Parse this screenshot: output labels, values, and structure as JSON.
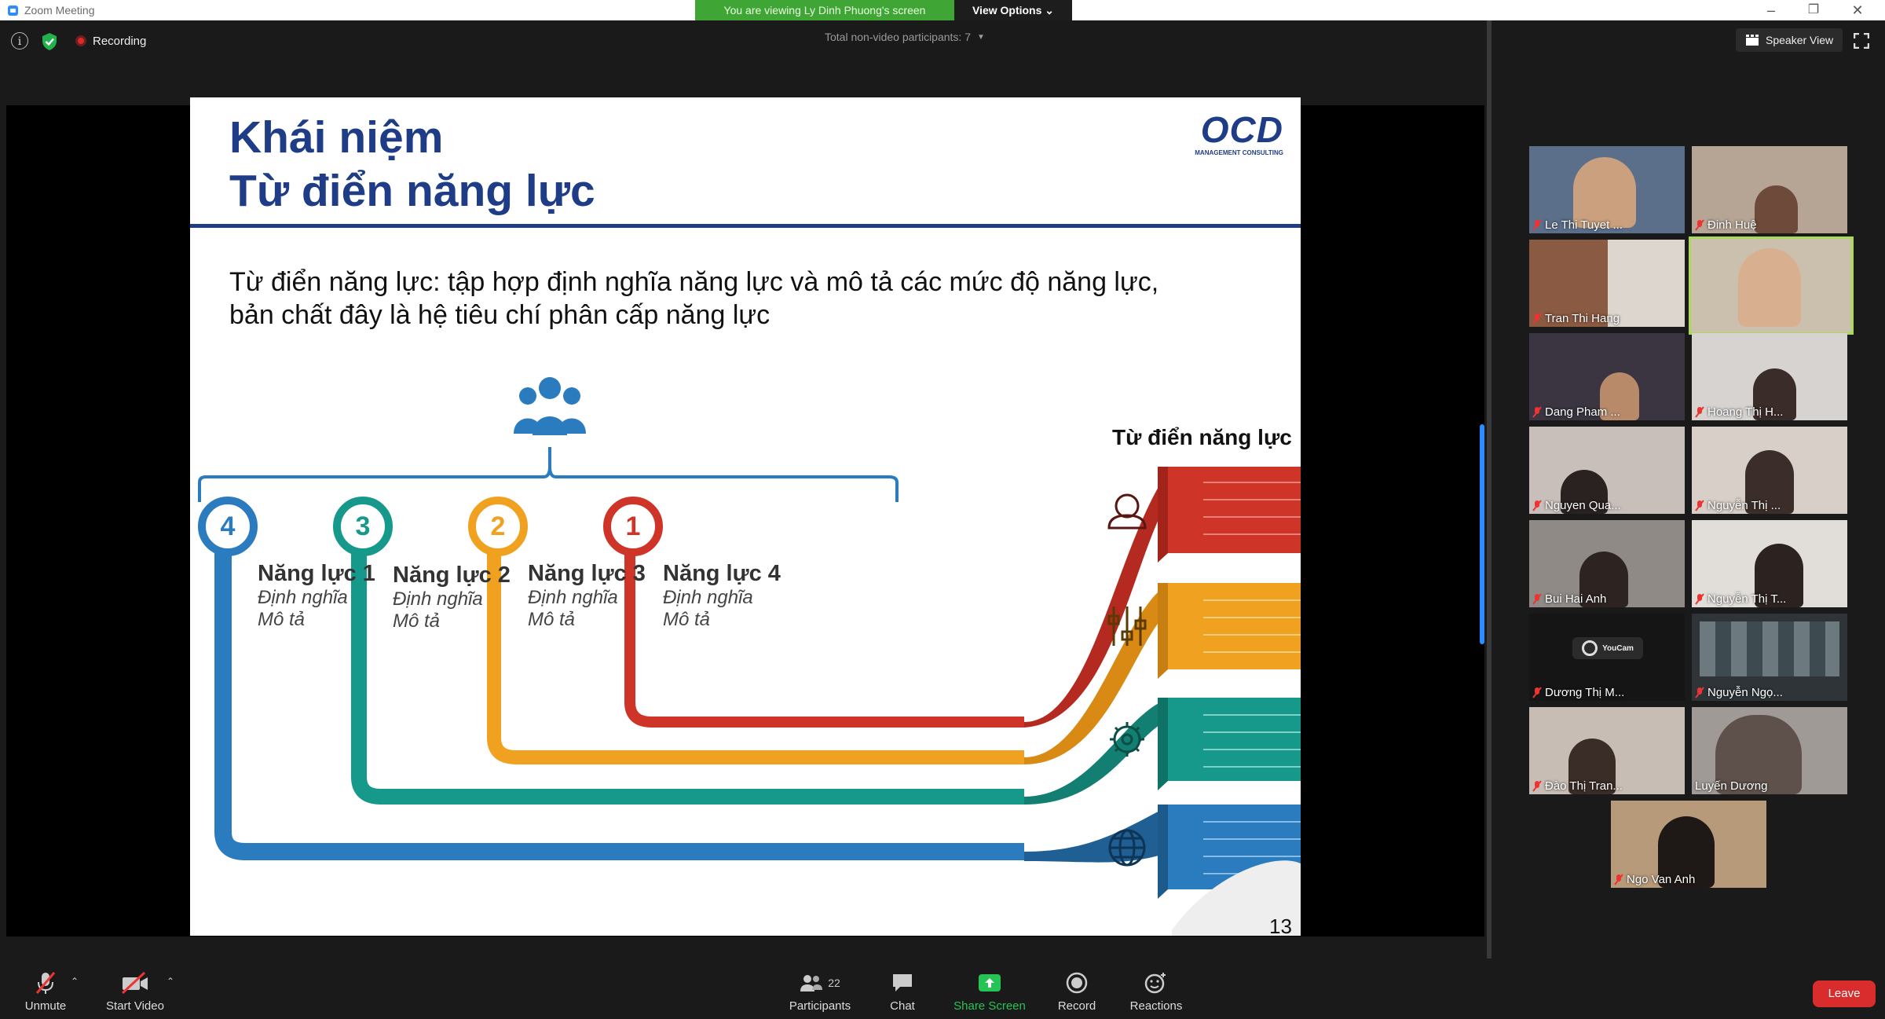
{
  "window": {
    "title": "Zoom Meeting",
    "minimize": "–",
    "restore": "❐",
    "close": "✕"
  },
  "banner": {
    "viewing_text": "You are viewing Ly Dinh Phuong's screen",
    "view_options": "View Options ⌄"
  },
  "topbar": {
    "recording": "Recording",
    "participants_text": "Total non-video participants: 7",
    "speaker_view": "Speaker View"
  },
  "slide": {
    "title_line1": "Khái niệm",
    "title_line2": "Từ điển năng lực",
    "logo_text": "OCD",
    "logo_sub": "MANAGEMENT CONSULTING",
    "desc_line1": "Từ điển năng lực: tập hợp định nghĩa năng lực và mô tả các mức độ năng lực,",
    "desc_line2": "bản chất đây là hệ tiêu chí phân cấp năng lực",
    "dict_label": "Từ điển năng lực",
    "page_number": "13",
    "capabilities": [
      {
        "number": "4",
        "name": "Năng lực 1",
        "definition": "Định nghĩa",
        "description": "Mô tả",
        "color": "#2a7cbf"
      },
      {
        "number": "3",
        "name": "Năng lực 2",
        "definition": "Định nghĩa",
        "description": "Mô tả",
        "color": "#16998a"
      },
      {
        "number": "2",
        "name": "Năng lực 3",
        "definition": "Định nghĩa",
        "description": "Mô tả",
        "color": "#f0a120"
      },
      {
        "number": "1",
        "name": "Năng lực 4",
        "definition": "Định nghĩa",
        "description": "Mô tả",
        "color": "#cf3428"
      }
    ],
    "ribbon_icons": [
      "person-icon",
      "sliders-icon",
      "gear-icon",
      "globe-icon"
    ]
  },
  "gallery": [
    {
      "name": "Le Thi Tuyet ...",
      "muted": true
    },
    {
      "name": "Đinh Huệ",
      "muted": true
    },
    {
      "name": "Tran Thi Hang",
      "muted": true
    },
    {
      "name": "",
      "muted": false
    },
    {
      "name": "Dang Pham ...",
      "muted": true
    },
    {
      "name": "Hoang Thị H...",
      "muted": true
    },
    {
      "name": "Nguyen Qua...",
      "muted": true
    },
    {
      "name": "Nguyễn Thị ...",
      "muted": true
    },
    {
      "name": "Bui Hai Anh",
      "muted": true
    },
    {
      "name": "Nguyễn Thị T...",
      "muted": true
    },
    {
      "name": "Dương Thị M...",
      "muted": true
    },
    {
      "name": "Nguyễn Ngọ...",
      "muted": true
    },
    {
      "name": "Đào Thị Tran...",
      "muted": true
    },
    {
      "name": "Luyến Dương",
      "muted": false
    },
    {
      "name": "Ngo Van Anh",
      "muted": true
    }
  ],
  "youcam_text": "YouCam",
  "toolbar": {
    "unmute": "Unmute",
    "start_video": "Start Video",
    "participants": "Participants",
    "participants_count": "22",
    "chat": "Chat",
    "share_screen": "Share Screen",
    "record": "Record",
    "reactions": "Reactions",
    "leave": "Leave"
  },
  "colors": {
    "accent": "#2d8cff",
    "share_green": "#26c454",
    "leave_red": "#d92c2c",
    "banner_green": "#3fa535",
    "slide_navy": "#1f3d87"
  }
}
